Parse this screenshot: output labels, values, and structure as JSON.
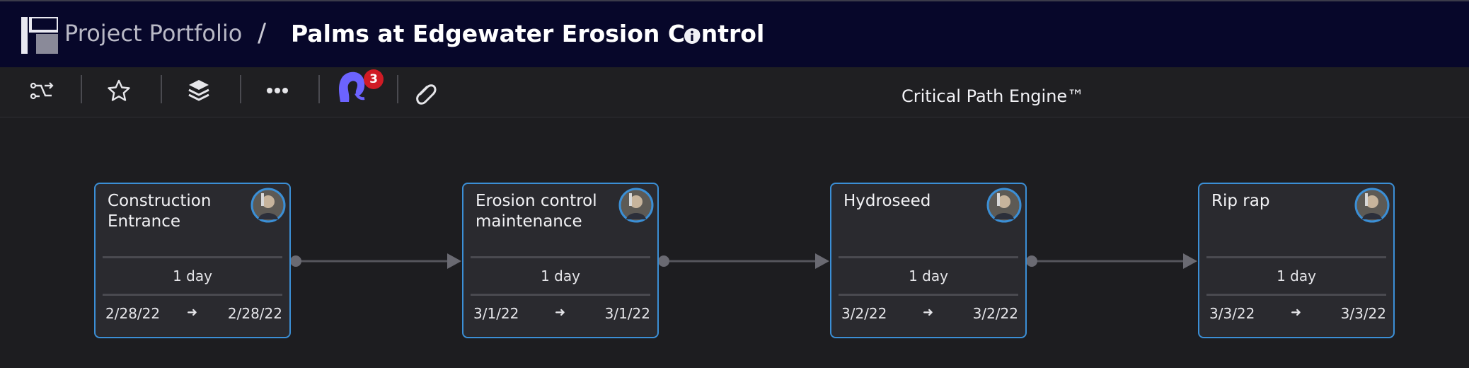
{
  "header": {
    "breadcrumb_parent": "Project Portfolio",
    "separator": "/",
    "title": "Palms at Edgewater Erosion Control"
  },
  "toolbar": {
    "notification_count": "3",
    "engine_label": "Critical Path Engine™"
  },
  "tasks": [
    {
      "title": "Construction Entrance",
      "duration": "1 day",
      "start": "2/28/22",
      "end": "2/28/22"
    },
    {
      "title": "Erosion control maintenance",
      "duration": "1 day",
      "start": "3/1/22",
      "end": "3/1/22"
    },
    {
      "title": "Hydroseed",
      "duration": "1 day",
      "start": "3/2/22",
      "end": "3/2/22"
    },
    {
      "title": "Rip rap",
      "duration": "1 day",
      "start": "3/3/22",
      "end": "3/3/22"
    }
  ],
  "arrow_symbol": "➜",
  "colors": {
    "header_bg": "#07072a",
    "card_border": "#3b8fd6",
    "badge": "#d01b25",
    "agent_icon": "#6c63ff"
  }
}
